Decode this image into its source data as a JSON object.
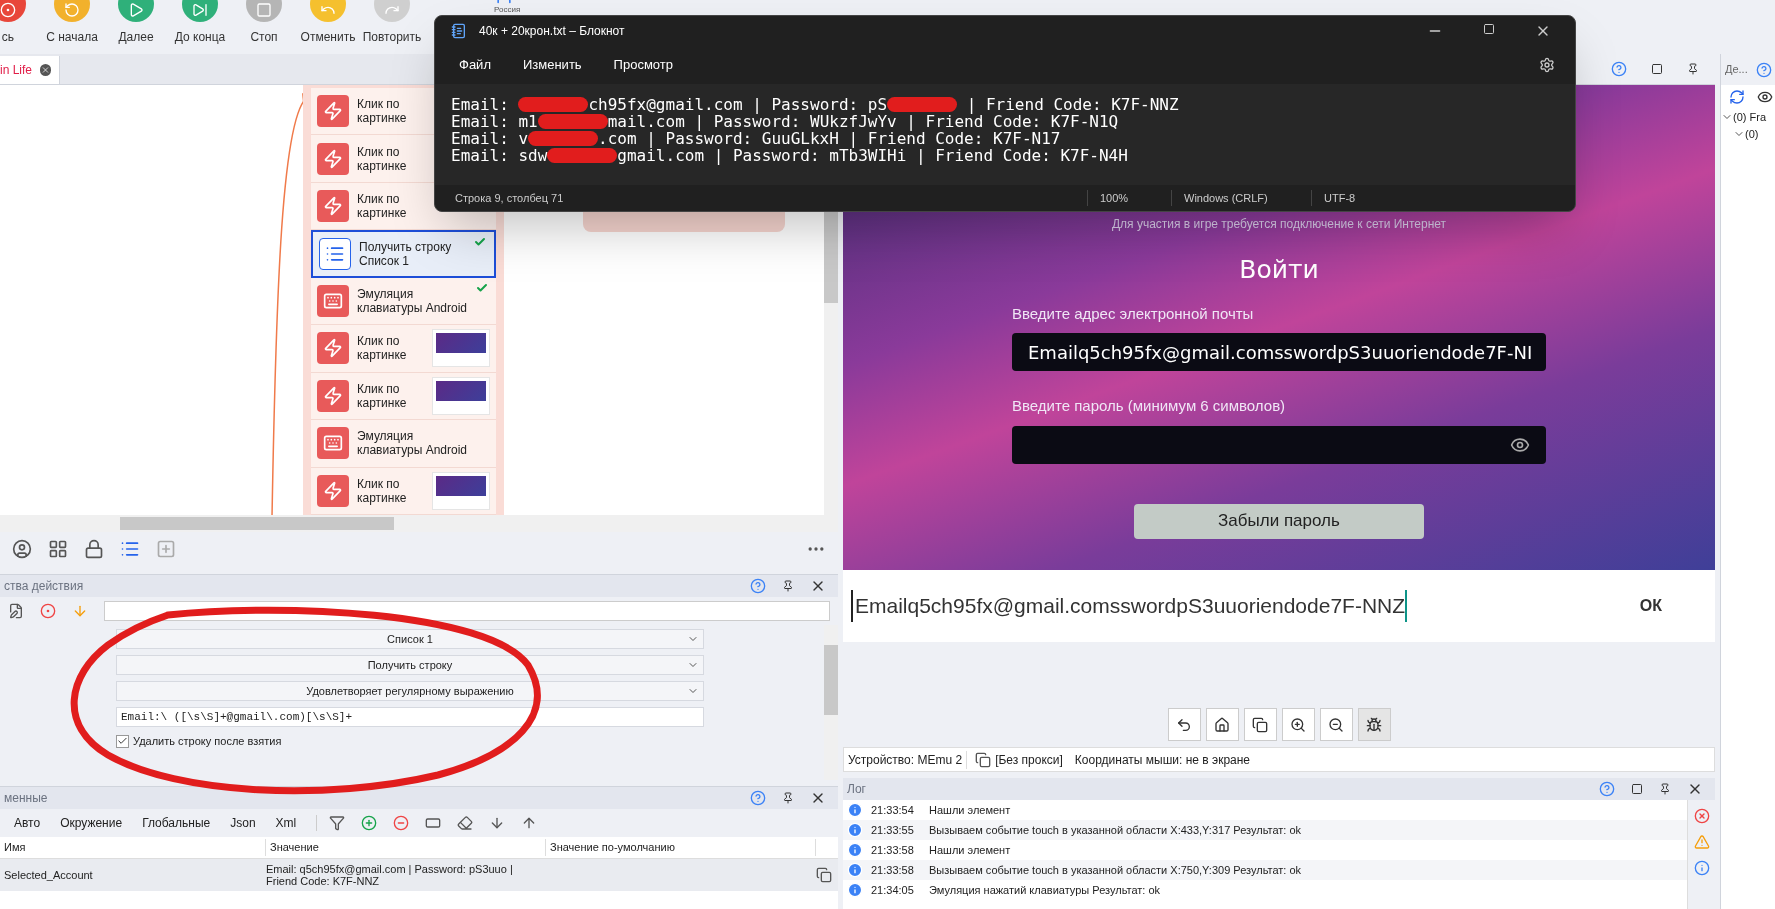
{
  "toolbar": {
    "buttons": [
      {
        "label": "сь",
        "color": "#e8463a"
      },
      {
        "label": "С начала",
        "color": "#f2b12c"
      },
      {
        "label": "Далее",
        "color": "#2fb07a"
      },
      {
        "label": "До конца",
        "color": "#2fb07a"
      },
      {
        "label": "Стоп",
        "color": "#b5b5b5"
      },
      {
        "label": "Отменить",
        "color": "#f5c02e"
      },
      {
        "label": "Повторить",
        "color": "#cfcfcf"
      }
    ],
    "profile_region": "Россия"
  },
  "project_tab": {
    "label": "in Life"
  },
  "actions": [
    {
      "kind": "click",
      "title": "Клик по\nкартинке",
      "thumbnail": false,
      "selected": false,
      "done": false
    },
    {
      "kind": "click",
      "title": "Клик по\nкартинке",
      "thumbnail": false,
      "selected": false,
      "done": false
    },
    {
      "kind": "click",
      "title": "Клик по\nкартинке",
      "thumbnail": false,
      "selected": false,
      "done": false
    },
    {
      "kind": "list",
      "title": "Получить строку\nСписок 1",
      "thumbnail": false,
      "selected": true,
      "done": true
    },
    {
      "kind": "keyboard",
      "title": "Эмуляция\nклавиатуры Android",
      "thumbnail": false,
      "selected": false,
      "done": true
    },
    {
      "kind": "click",
      "title": "Клик по\nкартинке",
      "thumbnail": true,
      "selected": false,
      "done": false
    },
    {
      "kind": "click",
      "title": "Клик по\nкартинке",
      "thumbnail": true,
      "selected": false,
      "done": false
    },
    {
      "kind": "keyboard",
      "title": "Эмуляция\nклавиатуры Android",
      "thumbnail": false,
      "selected": false,
      "done": false
    },
    {
      "kind": "click",
      "title": "Клик по\nкартинке",
      "thumbnail": true,
      "selected": false,
      "done": false
    }
  ],
  "properties": {
    "title": "ства действия",
    "dropdowns": [
      "Список 1",
      "Получить строку",
      "Удовлетворяет регулярному выражению"
    ],
    "regex": "Email:\\ ([\\s\\S]+@gmail\\.com)[\\s\\S]+",
    "checkbox": {
      "label": "Удалить строку после взятия",
      "checked": true
    }
  },
  "variables": {
    "title": "менные",
    "tabs": [
      {
        "label": "Авто",
        "selected": false
      },
      {
        "label": "Окружение",
        "selected": false
      },
      {
        "label": "Глобальные",
        "selected": false
      },
      {
        "label": "Json",
        "selected": false
      },
      {
        "label": "Xml",
        "selected": false
      }
    ],
    "columns": [
      "Имя",
      "Значение",
      "Значение по-умолчанию"
    ],
    "rows": [
      {
        "name": "Selected_Account",
        "value": "Email: q5ch95fx@gmail.com | Password: pS3uuo | Friend Code: K7F-NNZ"
      }
    ]
  },
  "emulator": {
    "notice": "Для участия в игре требуется подключение к  сети Интернет",
    "heading": "Войти",
    "email_label": "Введите адрес электронной почты",
    "email_value": "Emailq5ch95fx@gmail.comsswordpS3uuoriendode7F-NI",
    "password_label": "Введите пароль (минимум 6 символов)",
    "forgot_button": "Забыли пароль",
    "keyboard_input": "Emailq5ch95fx@gmail.comsswordpS3uuoriendode7F-NNZ",
    "keyboard_ok": "ОК",
    "status": {
      "device": "Устройство: MEmu 2",
      "proxy": "[Без прокси]",
      "mouse": "Координаты мыши: не в экране"
    }
  },
  "log": {
    "title": "Лог",
    "entries": [
      {
        "kind": "info",
        "time": "21:33:54",
        "message": "Нашли элемент"
      },
      {
        "kind": "info",
        "time": "21:33:55",
        "message": "Вызываем событие touch в указанной области X:433,Y:317  Результат: ok"
      },
      {
        "kind": "info",
        "time": "21:33:58",
        "message": "Нашли элемент"
      },
      {
        "kind": "info",
        "time": "21:33:58",
        "message": "Вызываем событие touch в указанной области X:750,Y:309  Результат: ok"
      },
      {
        "kind": "info",
        "time": "21:34:05",
        "message": "Эмуляция нажатий клавиатуры  Результат: ok"
      }
    ]
  },
  "side_panel": {
    "title": "Де...",
    "tree": [
      {
        "label": "(0) Fra",
        "expanded": true,
        "children": [
          {
            "label": "(0)",
            "expanded": true
          }
        ]
      }
    ]
  },
  "notepad": {
    "title": "40к + 20крон.txt – Блокнот",
    "menu": [
      "Файл",
      "Изменить",
      "Просмотр"
    ],
    "lines": [
      {
        "parts": [
          {
            "kind": "text",
            "text": "Email: "
          },
          {
            "kind": "redacted"
          },
          {
            "kind": "text",
            "text": "ch95fx@gmail.com | Password: pS"
          },
          {
            "kind": "redacted"
          },
          {
            "kind": "text",
            "text": " | Friend Code: K7F-NNZ"
          }
        ]
      },
      {
        "parts": [
          {
            "kind": "text",
            "text": "Email: m1"
          },
          {
            "kind": "redacted"
          },
          {
            "kind": "text",
            "text": "mail.com | Password: WUkzfJwYv | Friend Code: K7F-N1Q"
          }
        ]
      },
      {
        "parts": [
          {
            "kind": "text",
            "text": "Email: v"
          },
          {
            "kind": "redacted"
          },
          {
            "kind": "text",
            "text": ".com | Password: GuuGLkxH | Friend Code: K7F-N17"
          }
        ]
      },
      {
        "parts": [
          {
            "kind": "text",
            "text": "Email: sdw"
          },
          {
            "kind": "redacted"
          },
          {
            "kind": "text",
            "text": "gmail.com | Password: mTb3WIHi | Friend Code: K7F-N4H"
          }
        ]
      }
    ],
    "status": [
      "Строка 9, столбец 71",
      "100%",
      "Windows (CRLF)",
      "UTF-8"
    ]
  }
}
